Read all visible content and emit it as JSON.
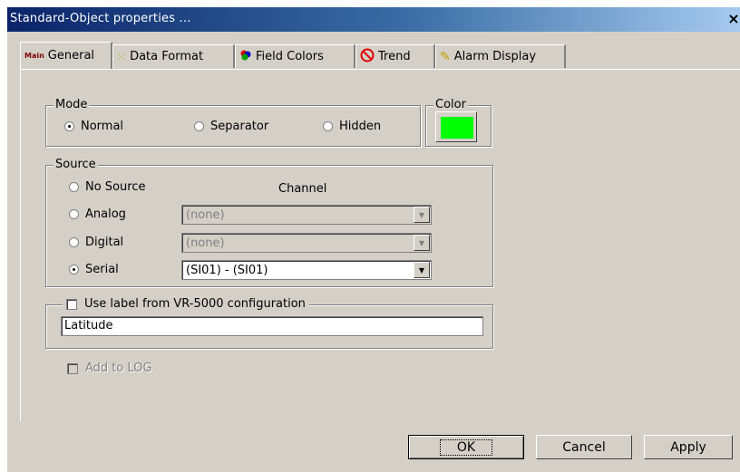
{
  "window": {
    "title": "Standard-Object properties ...",
    "close_glyph": "×"
  },
  "tabs": [
    {
      "label": "General",
      "icon": "main-label-icon",
      "icon_text": "Main"
    },
    {
      "label": "Data Format",
      "icon": "data-format-icon"
    },
    {
      "label": "Field Colors",
      "icon": "field-colors-icon"
    },
    {
      "label": "Trend",
      "icon": "trend-icon"
    },
    {
      "label": "Alarm Display",
      "icon": "alarm-display-icon"
    }
  ],
  "mode": {
    "legend": "Mode",
    "options": [
      "Normal",
      "Separator",
      "Hidden"
    ],
    "selected": "Normal"
  },
  "color": {
    "legend": "Color",
    "value": "#00ff00"
  },
  "source": {
    "legend": "Source",
    "channel_label": "Channel",
    "options": [
      "No Source",
      "Analog",
      "Digital",
      "Serial"
    ],
    "selected": "Serial",
    "analog_channel": "(none)",
    "digital_channel": "(none)",
    "serial_channel": "(SI01) - (SI01)"
  },
  "label_group": {
    "checkbox_label": "Use label from VR-5000 configuration",
    "checked": false,
    "text_value": "Latitude"
  },
  "add_to_log": {
    "label": "Add to LOG",
    "checked": false,
    "enabled": false
  },
  "buttons": {
    "ok": "OK",
    "cancel": "Cancel",
    "apply": "Apply"
  }
}
